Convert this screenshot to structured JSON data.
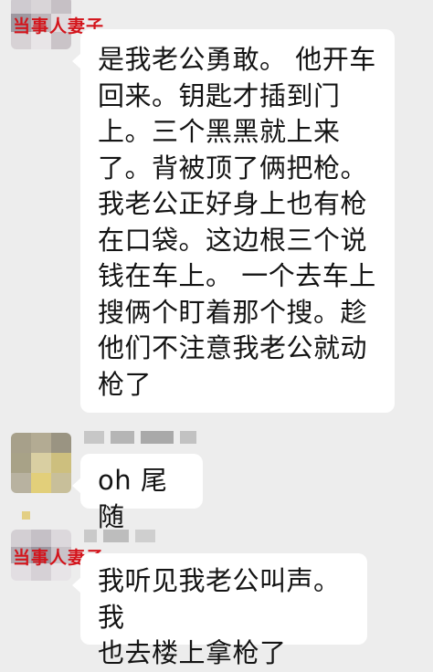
{
  "messages": [
    {
      "sender_label": "当事人妻子",
      "text": "是我老公勇敢。 他开车\n回来。钥匙才插到门\n上。三个黑黑就上来\n了。背被顶了俩把枪。\n我老公正好身上也有枪\n在口袋。这边根三个说\n钱在车上。 一个去车上\n搜俩个盯着那个搜。趁\n他们不注意我老公就动\n枪了",
      "label_color": "#d3141b"
    },
    {
      "sender_label": "",
      "text": "oh 尾随"
    },
    {
      "sender_label": "当事人妻子",
      "text": "我听见我老公叫声。我\n也去楼上拿枪了",
      "label_color": "#d3141b"
    }
  ],
  "colors": {
    "background": "#ededed",
    "bubble": "#ffffff",
    "label_red": "#d3141b"
  }
}
